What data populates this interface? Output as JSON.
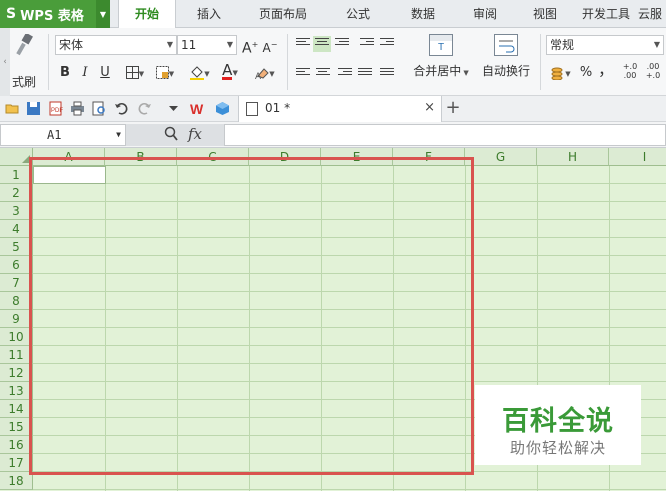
{
  "app": {
    "logo": "S",
    "name": "WPS 表格"
  },
  "menu": {
    "tabs": [
      {
        "label": "开始",
        "active": true
      },
      {
        "label": "插入"
      },
      {
        "label": "页面布局"
      },
      {
        "label": "公式"
      },
      {
        "label": "数据"
      },
      {
        "label": "审阅"
      },
      {
        "label": "视图"
      },
      {
        "label": "开发工具"
      },
      {
        "label": "云服"
      }
    ]
  },
  "ribbon": {
    "format_painter_label": "式刷",
    "font_name": "宋体",
    "font_size": "11",
    "grow_font": "A",
    "shrink_font": "A",
    "bold": "B",
    "italic": "I",
    "underline": "U",
    "font_color_glyph": "A",
    "merge_center_label": "合并居中",
    "wrap_text_label": "自动换行",
    "number_format": "常规",
    "percent": "%",
    "comma": "，",
    "inc_decimal": "+.0 .00",
    "dec_decimal": ".00 +.0",
    "colors": {
      "fill": "#f5d000",
      "font": "#e02020"
    }
  },
  "quickbar": {
    "doc_tab": {
      "name": "01 *",
      "close": "×"
    },
    "new_tab": "+"
  },
  "formula_bar": {
    "cell_ref": "A1",
    "fx": "fx",
    "value": ""
  },
  "sheet": {
    "columns": [
      "A",
      "B",
      "C",
      "D",
      "E",
      "F",
      "G",
      "H",
      "I"
    ],
    "rows": [
      "1",
      "2",
      "3",
      "4",
      "5",
      "6",
      "7",
      "8",
      "9",
      "10",
      "11",
      "12",
      "13",
      "14",
      "15",
      "16",
      "17",
      "18"
    ],
    "active_cell": "A1"
  },
  "watermark": {
    "title": "百科全说",
    "subtitle": "助你轻松解决"
  },
  "colors": {
    "brand_green": "#4a9d3a",
    "highlight_red": "#d9534f",
    "grid_bg": "#e2f2d7"
  }
}
